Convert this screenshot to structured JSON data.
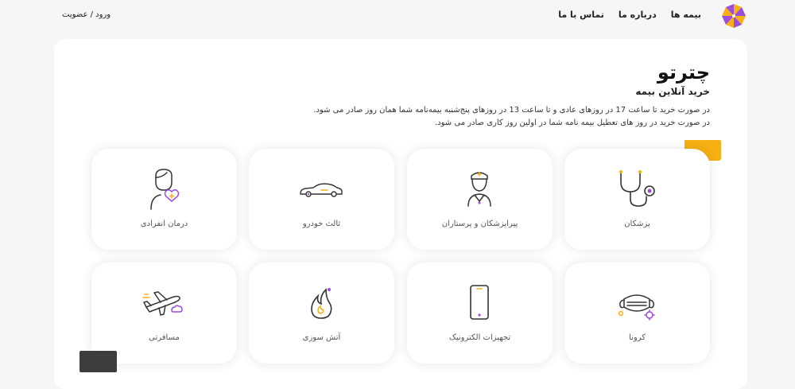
{
  "nav": {
    "items": [
      {
        "label": "بیمه ها"
      },
      {
        "label": "درباره ما"
      },
      {
        "label": "تماس با ما"
      }
    ],
    "login_label": "ورود / عضویت"
  },
  "hero": {
    "title": "چترتو",
    "subtitle": "خرید آنلاین بیمه",
    "note_line1": "در صورت خرید تا ساعت 17 در روزهای عادی و تا ساعت 13 در روزهای پنج‌شنبه بیمه‌نامه شما همان روز صادر می شود.",
    "note_line2": "در صورت خرید در روز های تعطیل بیمه نامه شما در اولین روز کاری صادر می شود."
  },
  "tiles": [
    {
      "label": "پزشکان",
      "icon": "stethoscope-icon"
    },
    {
      "label": "پیراپزشکان و پرستاران",
      "icon": "nurse-icon"
    },
    {
      "label": "ثالث خودرو",
      "icon": "car-icon"
    },
    {
      "label": "درمان انفرادی",
      "icon": "person-heart-icon"
    },
    {
      "label": "کرونا",
      "icon": "mask-virus-icon"
    },
    {
      "label": "تجهیزات الکترونیک",
      "icon": "phone-icon"
    },
    {
      "label": "آتش سوزی",
      "icon": "flame-icon"
    },
    {
      "label": "مسافرتی",
      "icon": "airplane-icon"
    }
  ],
  "colors": {
    "accent_purple": "#9b4ddb",
    "accent_orange": "#f6b013",
    "dark_block": "#3d3d3d",
    "card_bg": "#ffffff",
    "page_bg": "#f6f6f7"
  }
}
